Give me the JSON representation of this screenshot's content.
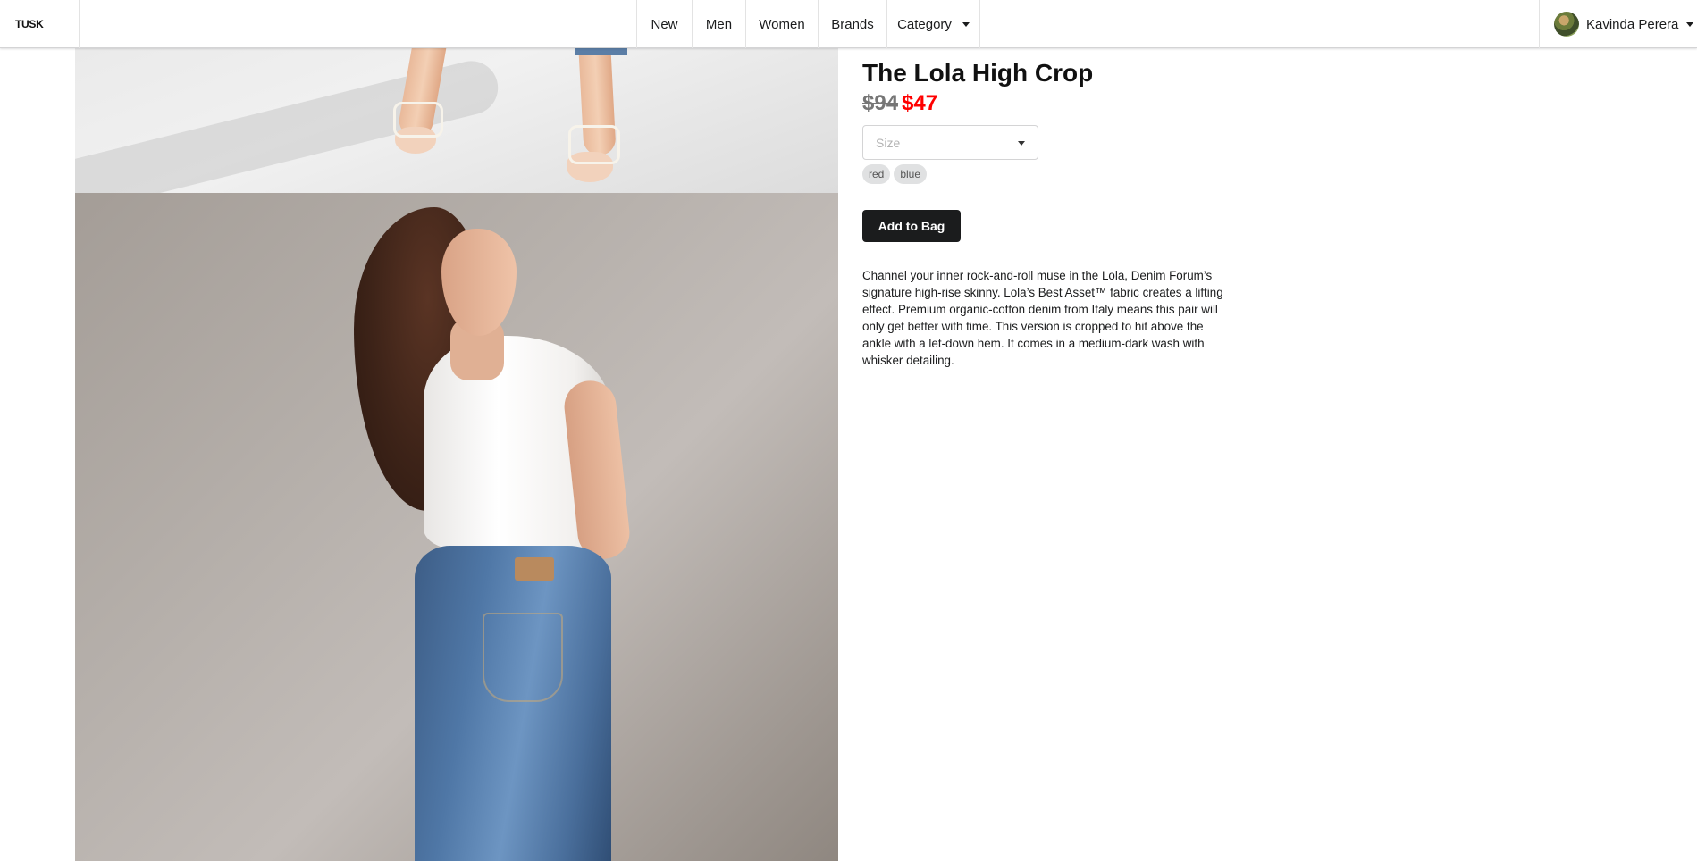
{
  "nav": {
    "logo": "TUSK",
    "items": [
      {
        "label": "New"
      },
      {
        "label": "Men"
      },
      {
        "label": "Women"
      },
      {
        "label": "Brands"
      },
      {
        "label": "Category"
      }
    ],
    "user": {
      "name": "Kavinda Perera",
      "avatar_icon": "user-avatar"
    }
  },
  "product": {
    "title": "The Lola High Crop",
    "price_original": "$94",
    "price_sale": "$47",
    "size_placeholder": "Size",
    "colors": [
      "red",
      "blue"
    ],
    "add_button_label": "Add to Bag",
    "description": "Channel your inner rock-and-roll muse in the Lola, Denim Forum’s signature high-rise skinny. Lola’s Best Asset™ fabric creates a lifting effect. Premium organic-cotton denim from Italy means this pair will only get better with time. This version is cropped to hit above the ankle with a let-down hem. It comes in a medium-dark wash with whisker detailing."
  },
  "theme": {
    "sale_color": "#ff0000",
    "button_color": "#1b1c1d",
    "tag_color": "#e0e1e2"
  }
}
